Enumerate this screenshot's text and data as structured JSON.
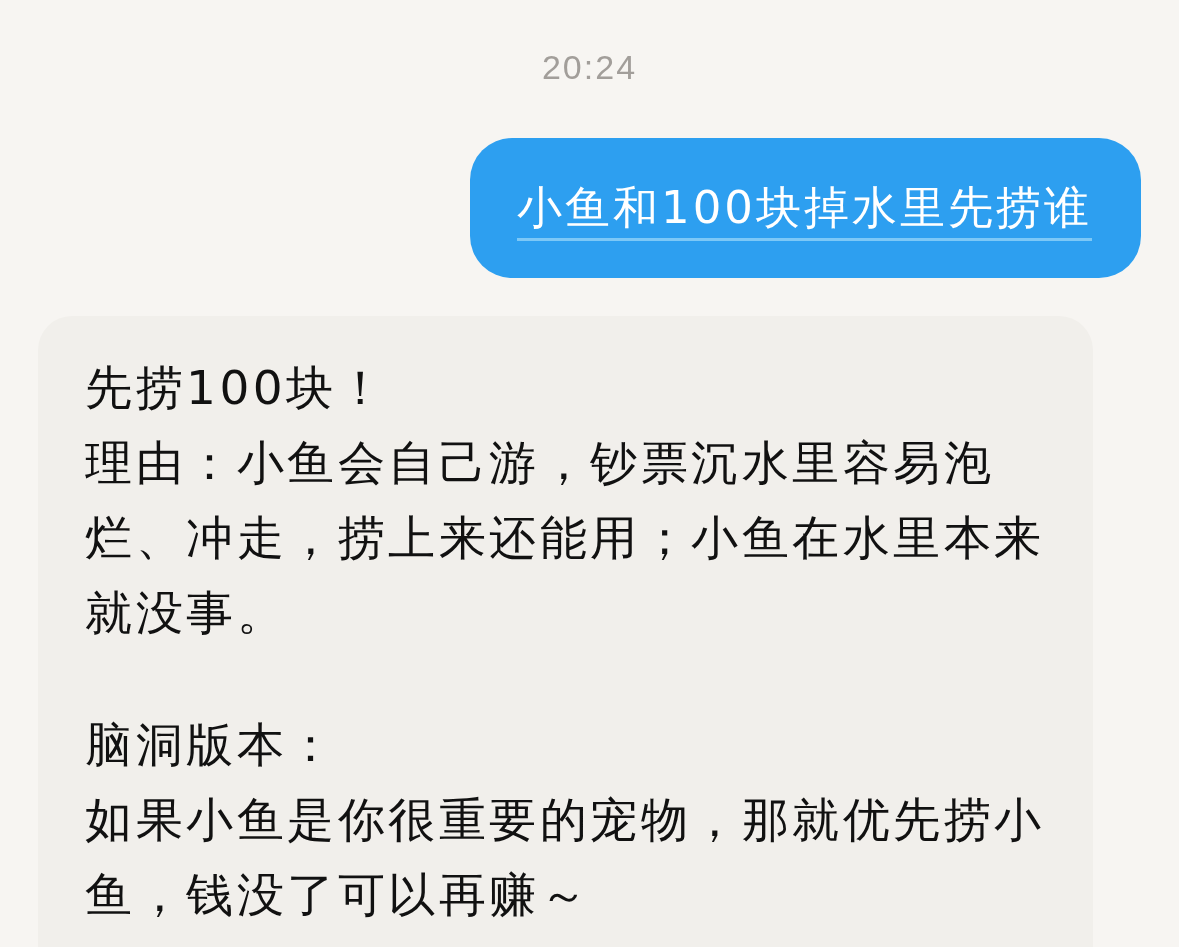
{
  "timestamp": "20:24",
  "messages": [
    {
      "kind": "sent",
      "paragraphs": [
        [
          "小鱼和100块掉水里先捞谁"
        ]
      ]
    },
    {
      "kind": "received",
      "paragraphs": [
        [
          "先捞100块！",
          "理由：小鱼会自己游，钞票沉水里容易泡烂、冲走，捞上来还能用；小鱼在水里本来就没事。"
        ],
        [
          "脑洞版本：",
          "如果小鱼是你很重要的宠物，那就优先捞小鱼，钱没了可以再赚～"
        ]
      ]
    }
  ]
}
